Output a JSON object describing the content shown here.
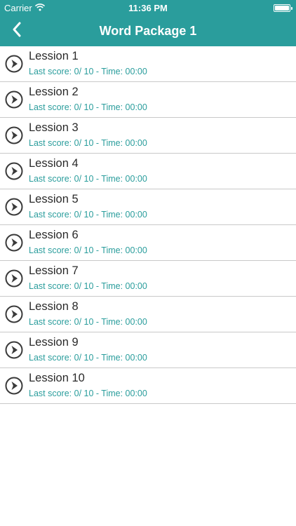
{
  "status_bar": {
    "carrier": "Carrier",
    "time": "11:36 PM",
    "wifi_icon": "wifi-icon",
    "battery_icon": "battery-icon",
    "battery_level": 1.0
  },
  "nav": {
    "title": "Word Package 1",
    "back_icon": "chevron-left-icon"
  },
  "colors": {
    "accent": "#2a9d9c",
    "header_text": "#ffffff",
    "title_text": "#2a2a2a",
    "separator": "#c9c9c9"
  },
  "lessons": [
    {
      "title": "Lession 1",
      "score": "Last score: 0/ 10 - Time: 00:00"
    },
    {
      "title": "Lession 2",
      "score": "Last score: 0/ 10 - Time: 00:00"
    },
    {
      "title": "Lession 3",
      "score": "Last score: 0/ 10 - Time: 00:00"
    },
    {
      "title": "Lession 4",
      "score": "Last score: 0/ 10 - Time: 00:00"
    },
    {
      "title": "Lession 5",
      "score": "Last score: 0/ 10 - Time: 00:00"
    },
    {
      "title": "Lession 6",
      "score": "Last score: 0/ 10 - Time: 00:00"
    },
    {
      "title": "Lession 7",
      "score": "Last score: 0/ 10 - Time: 00:00"
    },
    {
      "title": "Lession 8",
      "score": "Last score: 0/ 10 - Time: 00:00"
    },
    {
      "title": "Lession 9",
      "score": "Last score: 0/ 10 - Time: 00:00"
    },
    {
      "title": "Lession 10",
      "score": "Last score: 0/ 10 - Time: 00:00"
    }
  ],
  "row_icon": "play-circle-icon"
}
